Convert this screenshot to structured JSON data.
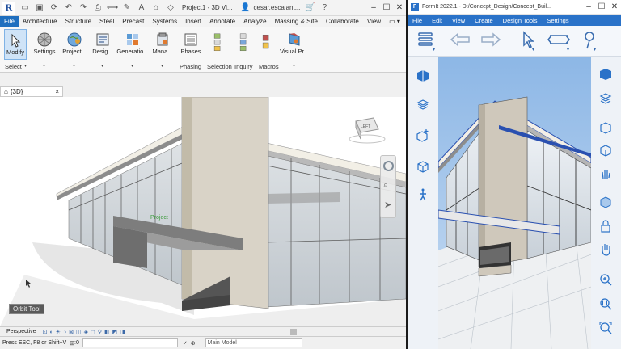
{
  "revit": {
    "title": "Project1 - 3D Vi...",
    "user": "cesar.escalant...",
    "tabs": [
      "File",
      "Architecture",
      "Structure",
      "Steel",
      "Precast",
      "Systems",
      "Insert",
      "Annotate",
      "Analyze",
      "Massing & Site",
      "Collaborate",
      "View"
    ],
    "active_tab": "File",
    "ribbon_buttons": [
      "Modify",
      "Settings",
      "Project...",
      "Desig...",
      "Generatio...",
      "Mana...",
      "Phases",
      "Visual Pr..."
    ],
    "panels": [
      "Select",
      "Phasing",
      "Selection",
      "Inquiry",
      "Macros"
    ],
    "view_tab": "{3D}",
    "view_close": "×",
    "orbit_tooltip": "Orbit Tool",
    "view_bar_label": "Perspective",
    "status_text": "Press ESC, F8 or Shift+V",
    "status_zero": ":0",
    "model_field": "Main Model",
    "viewcube_label": "LEFT",
    "canopy_label": "Project"
  },
  "formit": {
    "title": "FormIt 2022.1 - D:/Concept_Design/Concept_Buil...",
    "menu": [
      "File",
      "Edit",
      "View",
      "Create",
      "Design Tools",
      "Settings"
    ]
  },
  "icons": {
    "revit_logo": "R",
    "formit_logo": "F",
    "minimize": "–",
    "maximize": "☐",
    "close": "✕"
  }
}
